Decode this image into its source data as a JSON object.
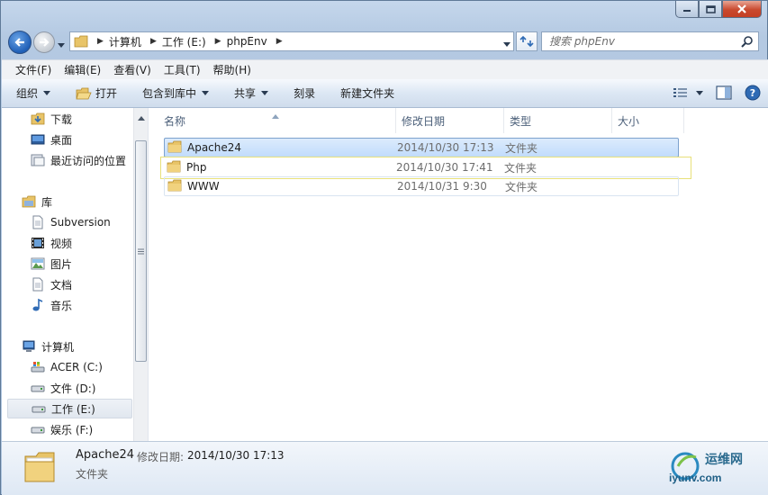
{
  "window": {
    "caption_buttons": [
      "minimize",
      "maximize",
      "close"
    ]
  },
  "address": {
    "crumbs": [
      "计算机",
      "工作 (E:)",
      "phpEnv"
    ]
  },
  "search": {
    "placeholder": "搜索 phpEnv"
  },
  "menu": [
    "文件(F)",
    "编辑(E)",
    "查看(V)",
    "工具(T)",
    "帮助(H)"
  ],
  "toolbar": {
    "organize": "组织",
    "open": "打开",
    "include_in_library": "包含到库中",
    "share": "共享",
    "burn": "刻录",
    "new_folder": "新建文件夹"
  },
  "nav": {
    "favorites": [
      {
        "label": "下载",
        "icon": "download-folder-icon"
      },
      {
        "label": "桌面",
        "icon": "desktop-icon"
      },
      {
        "label": "最近访问的位置",
        "icon": "recent-places-icon"
      }
    ],
    "libraries_label": "库",
    "libraries": [
      {
        "label": "Subversion",
        "icon": "document-library-icon"
      },
      {
        "label": "视频",
        "icon": "video-icon"
      },
      {
        "label": "图片",
        "icon": "picture-icon"
      },
      {
        "label": "文档",
        "icon": "document-icon"
      },
      {
        "label": "音乐",
        "icon": "music-icon"
      }
    ],
    "computer_label": "计算机",
    "drives": [
      {
        "label": "ACER (C:)",
        "icon": "system-drive-icon"
      },
      {
        "label": "文件 (D:)",
        "icon": "drive-icon"
      },
      {
        "label": "工作 (E:)",
        "icon": "drive-icon",
        "selected": true
      },
      {
        "label": "娱乐 (F:)",
        "icon": "drive-icon"
      }
    ]
  },
  "columns": {
    "name": "名称",
    "date": "修改日期",
    "type": "类型",
    "size": "大小"
  },
  "files": [
    {
      "name": "Apache24",
      "date": "2014/10/30 17:13",
      "type": "文件夹",
      "selected": true
    },
    {
      "name": "Php",
      "date": "2014/10/30 17:41",
      "type": "文件夹"
    },
    {
      "name": "WWW",
      "date": "2014/10/31 9:30",
      "type": "文件夹"
    }
  ],
  "details": {
    "name": "Apache24",
    "date_label": "修改日期:",
    "date_value": "2014/10/30 17:13",
    "type": "文件夹"
  },
  "watermark": {
    "cn": "运维网",
    "en": "iyunv.com"
  },
  "colors": {
    "selection": "#c1dcfc",
    "selection_border": "#7da2ce",
    "folder": "#e8c468"
  }
}
